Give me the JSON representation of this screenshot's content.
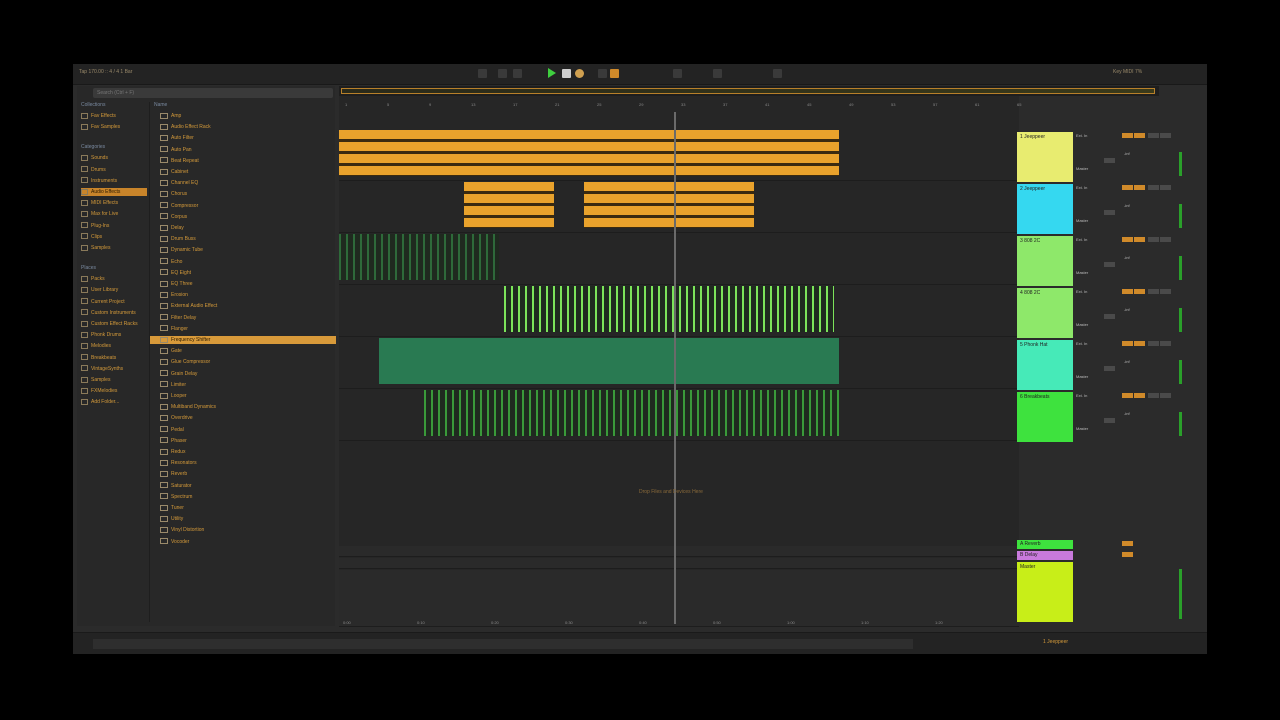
{
  "topbar": {
    "left_text": "Tap   170.00  ::  4 / 4   1 Bar",
    "right_text": "Key   MIDI   7%"
  },
  "browser": {
    "search_placeholder": "Search (Ctrl + F)",
    "collections_label": "Collections",
    "collections": [
      {
        "label": "Fav Effects"
      },
      {
        "label": "Fav Samples"
      }
    ],
    "categories_label": "Categories",
    "categories": [
      {
        "label": "Sounds"
      },
      {
        "label": "Drums"
      },
      {
        "label": "Instruments"
      },
      {
        "label": "Audio Effects",
        "selected": true
      },
      {
        "label": "MIDI Effects"
      },
      {
        "label": "Max for Live"
      },
      {
        "label": "Plug-Ins"
      },
      {
        "label": "Clips"
      },
      {
        "label": "Samples"
      }
    ],
    "places_label": "Places",
    "places": [
      {
        "label": "Packs"
      },
      {
        "label": "User Library"
      },
      {
        "label": "Current Project"
      },
      {
        "label": "Custom Instruments"
      },
      {
        "label": "Custom Effect Racks"
      },
      {
        "label": "Phonk Drums"
      },
      {
        "label": "Melodies"
      },
      {
        "label": "Breakbeats"
      },
      {
        "label": "VintageSynths"
      },
      {
        "label": "Samples"
      },
      {
        "label": "FXMelodies"
      },
      {
        "label": "Add Folder..."
      }
    ],
    "names_header": "Name",
    "names": [
      {
        "label": "Amp"
      },
      {
        "label": "Audio Effect Rack"
      },
      {
        "label": "Auto Filter"
      },
      {
        "label": "Auto Pan"
      },
      {
        "label": "Beat Repeat"
      },
      {
        "label": "Cabinet"
      },
      {
        "label": "Channel EQ"
      },
      {
        "label": "Chorus"
      },
      {
        "label": "Compressor"
      },
      {
        "label": "Corpus"
      },
      {
        "label": "Delay"
      },
      {
        "label": "Drum Buss"
      },
      {
        "label": "Dynamic Tube"
      },
      {
        "label": "Echo"
      },
      {
        "label": "EQ Eight"
      },
      {
        "label": "EQ Three"
      },
      {
        "label": "Erosion"
      },
      {
        "label": "External Audio Effect"
      },
      {
        "label": "Filter Delay"
      },
      {
        "label": "Flanger"
      },
      {
        "label": "Frequency Shifter",
        "selected": true
      },
      {
        "label": "Gate"
      },
      {
        "label": "Glue Compressor"
      },
      {
        "label": "Grain Delay"
      },
      {
        "label": "Limiter"
      },
      {
        "label": "Looper"
      },
      {
        "label": "Multiband Dynamics"
      },
      {
        "label": "Overdrive"
      },
      {
        "label": "Pedal"
      },
      {
        "label": "Phaser"
      },
      {
        "label": "Redux"
      },
      {
        "label": "Resonators"
      },
      {
        "label": "Reverb"
      },
      {
        "label": "Saturator"
      },
      {
        "label": "Spectrum"
      },
      {
        "label": "Tuner"
      },
      {
        "label": "Utility"
      },
      {
        "label": "Vinyl Distortion"
      },
      {
        "label": "Vocoder"
      }
    ]
  },
  "arrangement": {
    "ruler_marks": [
      "1",
      "5",
      "9",
      "13",
      "17",
      "21",
      "25",
      "29",
      "33",
      "37",
      "41",
      "45",
      "49",
      "53",
      "57",
      "61",
      "65"
    ],
    "time_marks": [
      "0:00",
      "0:10",
      "0:20",
      "0:30",
      "0:40",
      "0:50",
      "1:00",
      "1:10",
      "1:20"
    ],
    "drop_hint": "Drop Files and Devices Here"
  },
  "tracks": [
    {
      "name": "1 Jeeppeer",
      "color": "#e8ec70",
      "clip_color": "#e9a22c"
    },
    {
      "name": "2 Jeeppeer",
      "color": "#35d8f0",
      "clip_color": "#e9a22c"
    },
    {
      "name": "3 808 2C",
      "color": "#8ee86a",
      "clip_color": "#2e6a3a"
    },
    {
      "name": "4 808 2C",
      "color": "#8ee86a",
      "clip_color": "#7ce45a"
    },
    {
      "name": "5 Phonk Hat",
      "color": "#46eab8",
      "clip_color": "#2a8a5a"
    },
    {
      "name": "6 Breakbeats",
      "color": "#3ee23e",
      "clip_color": "#3a9a3a"
    }
  ],
  "returns": [
    {
      "name": "A Reverb",
      "color": "#3ee23e"
    },
    {
      "name": "B Delay",
      "color": "#c87adc"
    }
  ],
  "master": {
    "name": "Master",
    "color": "#c8ee18"
  },
  "mixer": {
    "in_label": "Ext. In",
    "out_label": "Master",
    "vol": "-inf"
  },
  "status": {
    "track_name": "1 Jeeppeer"
  }
}
